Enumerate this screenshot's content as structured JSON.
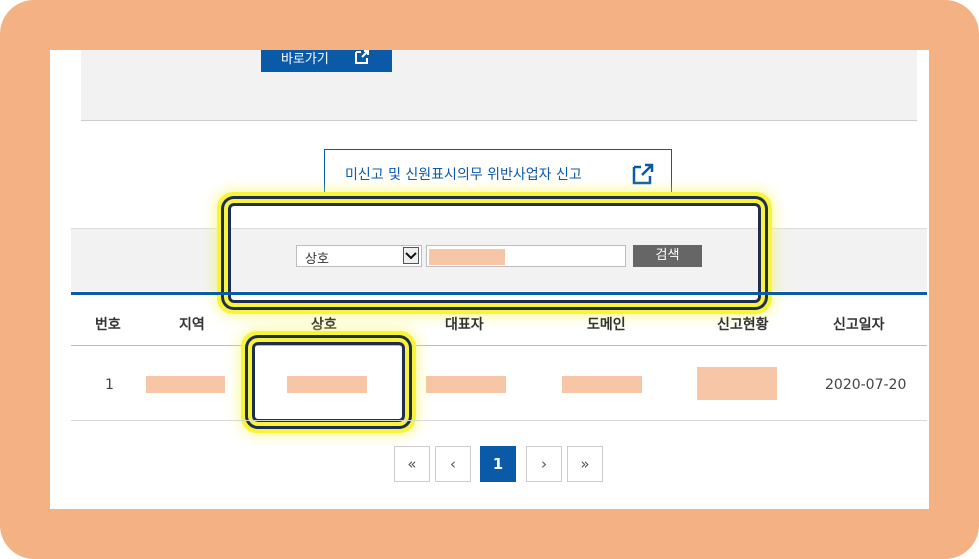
{
  "go_button": {
    "label": "바로가기",
    "icon": "external-link-icon"
  },
  "report_button": {
    "label": "미신고 및 신원표시의무 위반사업자 신고",
    "icon": "external-link-icon"
  },
  "search": {
    "field_value": "상호",
    "input_value": "",
    "button_label": "검색"
  },
  "table": {
    "headers": [
      "번호",
      "지역",
      "상호",
      "대표자",
      "도메인",
      "신고현황",
      "신고일자"
    ],
    "rows": [
      {
        "number": "1",
        "date": "2020-07-20"
      }
    ]
  },
  "pagination": {
    "first": "«",
    "prev": "‹",
    "current": "1",
    "next": "›",
    "last": "»"
  },
  "colors": {
    "accent": "#0a5aa8",
    "highlight": "#f7f43a",
    "frame": "#f4b183",
    "redaction": "#f6c6a6"
  }
}
